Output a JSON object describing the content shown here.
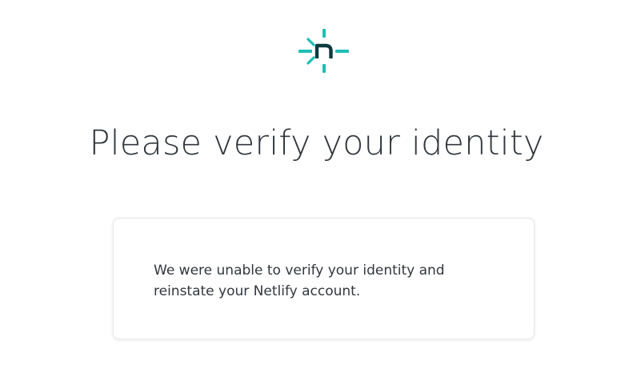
{
  "logo": {
    "icon": "netlify-logo-icon",
    "color_primary": "#1ebeb4",
    "color_letter": "#0e3b3f"
  },
  "main": {
    "title": "Please verify your identity"
  },
  "card": {
    "message": "We were unable to verify your identity and reinstate your Netlify account."
  }
}
